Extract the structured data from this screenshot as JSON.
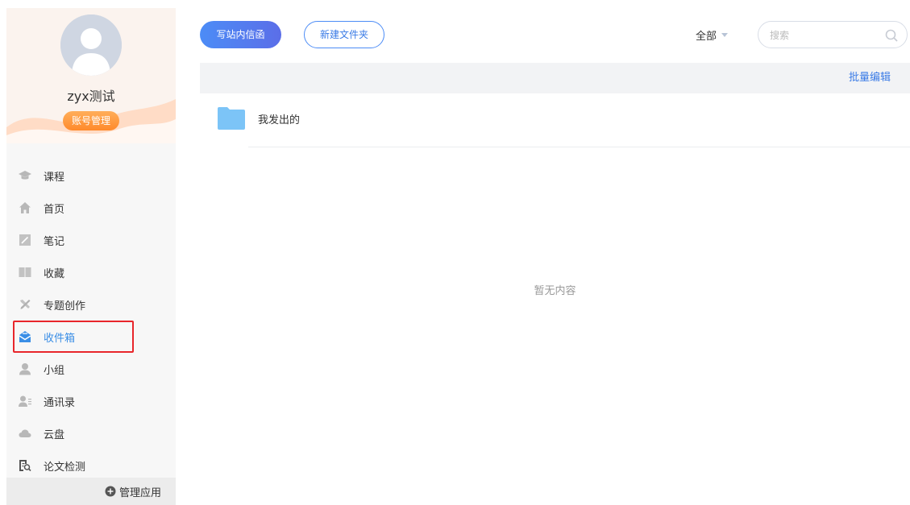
{
  "sidebar": {
    "username": "zyx测试",
    "account_button": "账号管理",
    "items": [
      {
        "label": "课程",
        "icon": "graduation-cap-icon"
      },
      {
        "label": "首页",
        "icon": "home-icon"
      },
      {
        "label": "笔记",
        "icon": "note-icon"
      },
      {
        "label": "收藏",
        "icon": "book-icon"
      },
      {
        "label": "专题创作",
        "icon": "tools-icon"
      },
      {
        "label": "收件箱",
        "icon": "inbox-icon",
        "active": true
      },
      {
        "label": "小组",
        "icon": "user-icon"
      },
      {
        "label": "通讯录",
        "icon": "contacts-icon"
      },
      {
        "label": "云盘",
        "icon": "cloud-icon"
      },
      {
        "label": "论文检测",
        "icon": "document-search-icon"
      }
    ],
    "manage_apps": "管理应用"
  },
  "toolbar": {
    "compose_label": "写站内信函",
    "new_folder_label": "新建文件夹",
    "filter_label": "全部",
    "search_placeholder": "搜索"
  },
  "list": {
    "bulk_edit_label": "批量编辑",
    "folders": [
      {
        "name": "我发出的",
        "icon": "folder-icon"
      }
    ],
    "empty_text": "暂无内容"
  },
  "colors": {
    "accent": "#3a7be6",
    "active_nav": "#3a8ee6",
    "account_button": "#ff8a2b",
    "highlight": "#e8262b",
    "folder": "#7cc4f7"
  }
}
